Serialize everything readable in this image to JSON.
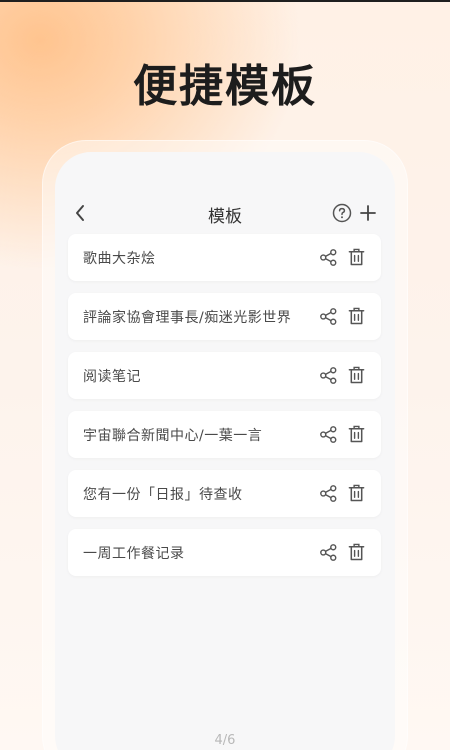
{
  "hero": {
    "title": "便捷模板"
  },
  "nav": {
    "title": "模板"
  },
  "templates": [
    {
      "label": "歌曲大杂烩"
    },
    {
      "label": "評論家協會理事長/痴迷光影世界"
    },
    {
      "label": "阅读笔记"
    },
    {
      "label": "宇宙聯合新聞中心/一葉一言"
    },
    {
      "label": "您有一份「日报」待查收"
    },
    {
      "label": "一周工作餐记录"
    }
  ],
  "pager": {
    "text": "4/6"
  },
  "icons": {
    "back": "chevron-left-icon",
    "help": "question-circle-icon",
    "add": "plus-icon",
    "share": "share-icon",
    "delete": "trash-icon"
  },
  "colors": {
    "accent_glow": "#ffc48f",
    "background": "#fdf3ec",
    "card": "#ffffff",
    "text": "#4a4a4a",
    "icon": "#555555"
  }
}
